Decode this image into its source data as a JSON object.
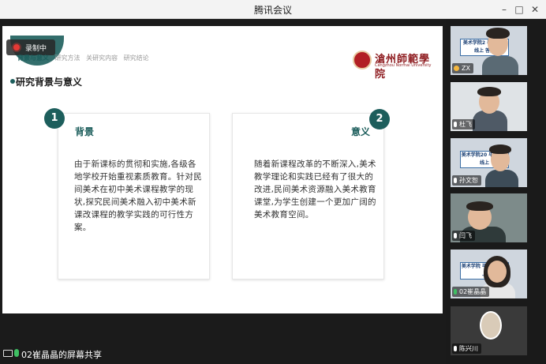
{
  "window": {
    "title": "腾讯会议",
    "controls": {
      "minimize": "–",
      "maximize": "□",
      "close": "✕"
    }
  },
  "recording": {
    "label": "录制中"
  },
  "slide": {
    "nav": [
      "背景与意义",
      "研究方法",
      "关研究内容",
      "研究结论"
    ],
    "logo_cn": "滄州師範學院",
    "logo_en": "Cangzhou Normal University",
    "heading": "研究背景与意义",
    "cards": [
      {
        "number": "1",
        "title": "背景",
        "body": "由于新课标的贯彻和实施,各级各地学校开始重视素质教育。针对民间美术在初中美术课程教学的现状,探究民间美术融入初中美术新课改课程的教学实践的可行性方案。"
      },
      {
        "number": "2",
        "title": "意义",
        "body": "随着新课程改革的不断深入,美术教学理论和实践已经有了很大的改进,民间美术资源融入美术教育课堂,为学生创建一个更加广阔的美术教育空间。"
      }
    ]
  },
  "share_bar": {
    "label": "02崔晶晶的屏幕共享"
  },
  "participants": [
    {
      "name": "ZX",
      "poster_text": "美术学院2 毕业论文 线上 答辩",
      "icon": "user-icon"
    },
    {
      "name": "杜飞",
      "icon": "mic-icon"
    },
    {
      "name": "孙文恕",
      "poster_text": "美术学院20 毕业论文 线上",
      "icon": "mic-icon"
    },
    {
      "name": "闫飞",
      "icon": "mic-icon"
    },
    {
      "name": "02崔晶晶",
      "poster_text": "美术学院 毕业论文 线上",
      "icon": "mic-icon"
    },
    {
      "name": "陈兴川",
      "icon": "mic-icon"
    }
  ],
  "colors": {
    "accent": "#1d5e5c",
    "brand_red": "#8e1b1f",
    "record": "#e53935",
    "mic_on": "#3fbf63"
  }
}
